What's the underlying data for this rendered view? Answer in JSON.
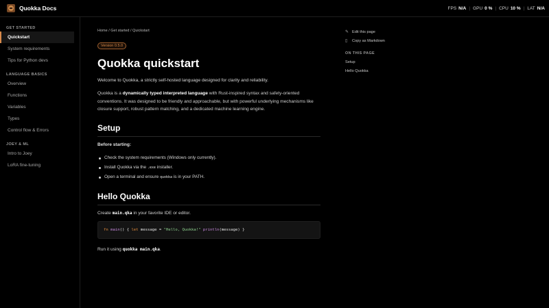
{
  "header": {
    "brand": "Quokka Docs",
    "stats": [
      {
        "label": "FPS",
        "value": "N/A"
      },
      {
        "label": "GPU",
        "value": "0 %"
      },
      {
        "label": "CPU",
        "value": "10 %"
      },
      {
        "label": "LAT",
        "value": "N/A"
      }
    ]
  },
  "sidebar": {
    "sections": [
      {
        "title": "GET STARTED",
        "items": [
          "Quickstart",
          "System requirements",
          "Tips for Python devs"
        ]
      },
      {
        "title": "LANGUAGE BASICS",
        "items": [
          "Overview",
          "Functions",
          "Variables",
          "Types",
          "Control flow & Errors"
        ]
      },
      {
        "title": "JOEY & ML",
        "items": [
          "Intro to Joey",
          "LoRA fine-tuning"
        ]
      }
    ],
    "active": "Quickstart"
  },
  "main": {
    "breadcrumb": "Home / Get started / Quickstart",
    "version": "Version 0.5.0",
    "title": "Quokka quickstart",
    "intro": "Welcome to Quokka, a strictly self-hosted language designed for clarity and reliability.",
    "para": {
      "pre": "Quokka is a ",
      "bold": "dynamically typed interpreted language",
      "post": " with Rust-inspired syntax and safety-oriented conventions. It was designed to be friendly and approachable, but with powerful underlying mechanisms like closure support, robust pattern matching, and a dedicated machine learning engine."
    },
    "setup": {
      "heading": "Setup",
      "before": "Before starting:",
      "b1": "Check the system requirements (Windows only currently).",
      "b2_pre": "Install Quokka via the ",
      "b2_code": ".exe",
      "b2_post": " installer.",
      "b3_pre": "Open a terminal and ensure ",
      "b3_code": "quokka",
      "b3_post": " is in your PATH."
    },
    "hello": {
      "heading": "Hello Quokka",
      "create_pre": "Create ",
      "create_code": "main.qka",
      "create_post": " in your favorite IDE or editor.",
      "code": {
        "t1": "fn",
        "t2": " main",
        "t3": "() { ",
        "t4": "let",
        "t5": " message = ",
        "t6": "\"Hello, Quokka!\"",
        "t7": " println",
        "t8": "(message) }"
      },
      "run_pre": "Run it using ",
      "run_code": "quokka main.qka",
      "run_post": "."
    }
  },
  "right": {
    "edit": "Edit this page",
    "copy": "Copy as Markdown",
    "on_this_page": "ON THIS PAGE",
    "toc": [
      "Setup",
      "Hello Quokka"
    ]
  }
}
